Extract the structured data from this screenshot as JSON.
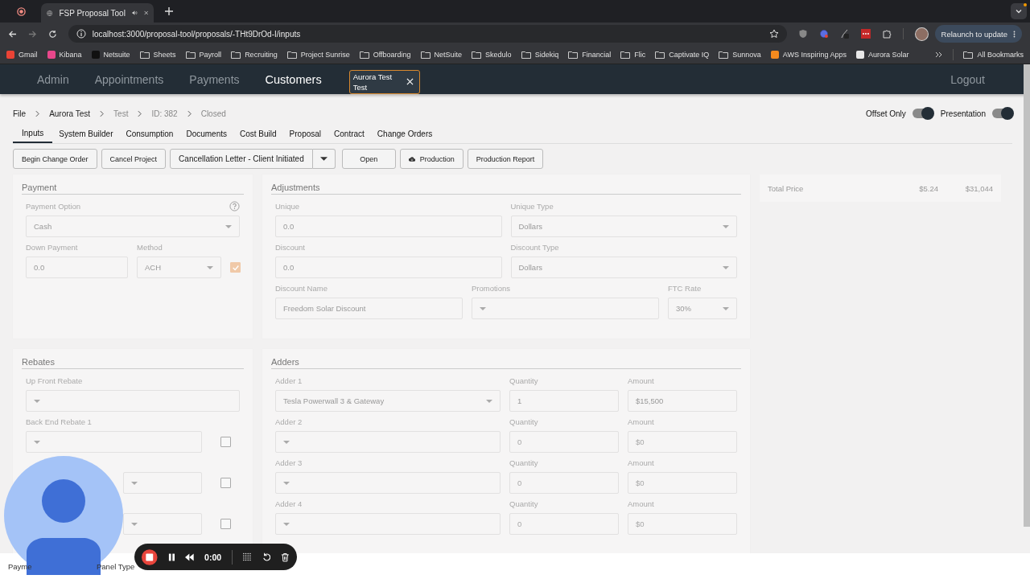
{
  "browser": {
    "tab_title": "FSP Proposal Tool",
    "url": "localhost:3000/proposal-tool/proposals/-THt9DrOd-I/inputs",
    "relaunch": "Relaunch to update",
    "all_bookmarks": "All Bookmarks",
    "bookmarks": [
      {
        "label": "Gmail",
        "kind": "app",
        "color": "#ea4335"
      },
      {
        "label": "Kibana",
        "kind": "app",
        "color": "#e8478b"
      },
      {
        "label": "Netsuite",
        "kind": "app",
        "color": "#111111"
      },
      {
        "label": "Sheets",
        "kind": "folder"
      },
      {
        "label": "Payroll",
        "kind": "folder"
      },
      {
        "label": "Recruiting",
        "kind": "folder"
      },
      {
        "label": "Project Sunrise",
        "kind": "folder"
      },
      {
        "label": "Offboarding",
        "kind": "folder"
      },
      {
        "label": "NetSuite",
        "kind": "folder"
      },
      {
        "label": "Skedulo",
        "kind": "folder"
      },
      {
        "label": "Sidekiq",
        "kind": "folder"
      },
      {
        "label": "Financial",
        "kind": "folder"
      },
      {
        "label": "Flic",
        "kind": "folder"
      },
      {
        "label": "Captivate IQ",
        "kind": "folder"
      },
      {
        "label": "Sunnova",
        "kind": "folder"
      },
      {
        "label": "AWS Inspiring Apps",
        "kind": "app",
        "color": "#f48a1e"
      },
      {
        "label": "Aurora Solar",
        "kind": "app",
        "color": "#e8e8e8"
      }
    ]
  },
  "nav": {
    "items": [
      {
        "label": "Admin",
        "selected": false
      },
      {
        "label": "Appointments",
        "selected": false
      },
      {
        "label": "Payments",
        "selected": false
      },
      {
        "label": "Customers",
        "selected": true
      }
    ],
    "customer_tab": "Aurora Test Test",
    "logout": "Logout"
  },
  "breadcrumb": [
    {
      "label": "File",
      "link": true
    },
    {
      "label": "Aurora Test",
      "link": true
    },
    {
      "label": "Test",
      "link": false
    },
    {
      "label": "ID: 382",
      "link": false
    },
    {
      "label": "Closed",
      "link": false
    }
  ],
  "toggles": [
    {
      "label": "Offset Only",
      "on": true
    },
    {
      "label": "Presentation",
      "on": true
    }
  ],
  "tabs": [
    {
      "label": "Inputs",
      "selected": true
    },
    {
      "label": "System Builder",
      "selected": false
    },
    {
      "label": "Consumption",
      "selected": false
    },
    {
      "label": "Documents",
      "selected": false
    },
    {
      "label": "Cost Build",
      "selected": false
    },
    {
      "label": "Proposal",
      "selected": false
    },
    {
      "label": "Contract",
      "selected": false
    },
    {
      "label": "Change Orders",
      "selected": false
    }
  ],
  "actions": [
    {
      "label": "Begin Change Order",
      "kind": "button"
    },
    {
      "label": "Cancel Project",
      "kind": "button"
    },
    {
      "label": "Cancellation Letter - Client Initiated",
      "kind": "split"
    },
    {
      "label": "Open",
      "kind": "button"
    },
    {
      "label": "Production",
      "kind": "cloud"
    },
    {
      "label": "Production Report",
      "kind": "button"
    }
  ],
  "panels": [
    {
      "title": "Payment",
      "rows": [
        [
          {
            "kind": "select",
            "label": "Payment Option",
            "value": "Cash",
            "help": true
          }
        ],
        [
          {
            "kind": "input",
            "label": "Down Payment",
            "value": "0.0"
          },
          {
            "kind": "select",
            "label": "Method",
            "value": "ACH"
          },
          {
            "kind": "checkbox",
            "checked": true
          }
        ]
      ]
    },
    {
      "title": "Adjustments",
      "rows": [
        [
          {
            "kind": "input",
            "label": "Unique",
            "value": "0.0"
          },
          {
            "kind": "select",
            "label": "Unique Type",
            "value": "Dollars"
          }
        ],
        [
          {
            "kind": "input",
            "label": "Discount",
            "value": "0.0"
          },
          {
            "kind": "select",
            "label": "Discount Type",
            "value": "Dollars"
          }
        ],
        [
          {
            "kind": "input",
            "label": "Discount Name",
            "value": "Freedom Solar Discount"
          },
          {
            "kind": "select",
            "label": "Promotions"
          },
          {
            "kind": "select",
            "label": "FTC Rate",
            "value": "30%"
          }
        ]
      ]
    },
    {
      "title": "Rebates",
      "rows": [
        [
          {
            "kind": "select",
            "label": "Up Front Rebate"
          }
        ],
        [
          {
            "kind": "select",
            "label": "Back End Rebate 1"
          },
          {
            "kind": "checkbox",
            "checked": false
          }
        ],
        [
          {
            "kind": "select"
          },
          {
            "kind": "checkbox",
            "checked": false
          }
        ],
        [
          {
            "kind": "select"
          },
          {
            "kind": "checkbox",
            "checked": false
          }
        ]
      ]
    },
    {
      "title": "Adders",
      "rows": [
        [
          {
            "kind": "select",
            "label": "Adder 1",
            "value": "Tesla Powerwall 3 & Gateway"
          },
          {
            "kind": "input",
            "label": "Quantity",
            "value": "1"
          },
          {
            "kind": "input",
            "label": "Amount",
            "value": "$15,500"
          }
        ],
        [
          {
            "kind": "select",
            "label": "Adder 2"
          },
          {
            "kind": "input",
            "label": "Quantity",
            "placeholder": "0"
          },
          {
            "kind": "input",
            "label": "Amount",
            "placeholder": "$0"
          }
        ],
        [
          {
            "kind": "select",
            "label": "Adder 3"
          },
          {
            "kind": "input",
            "label": "Quantity",
            "placeholder": "0"
          },
          {
            "kind": "input",
            "label": "Amount",
            "placeholder": "$0"
          }
        ],
        [
          {
            "kind": "select",
            "label": "Adder 4"
          },
          {
            "kind": "input",
            "label": "Quantity",
            "placeholder": "0"
          },
          {
            "kind": "input",
            "label": "Amount",
            "placeholder": "$0"
          }
        ]
      ]
    }
  ],
  "summary": {
    "label": "Total Price",
    "per_watt": "$5.24",
    "total": "$31,044"
  },
  "bottom_bar": [
    "Payme",
    "Panel Type"
  ],
  "recorder": {
    "time": "0:00"
  }
}
